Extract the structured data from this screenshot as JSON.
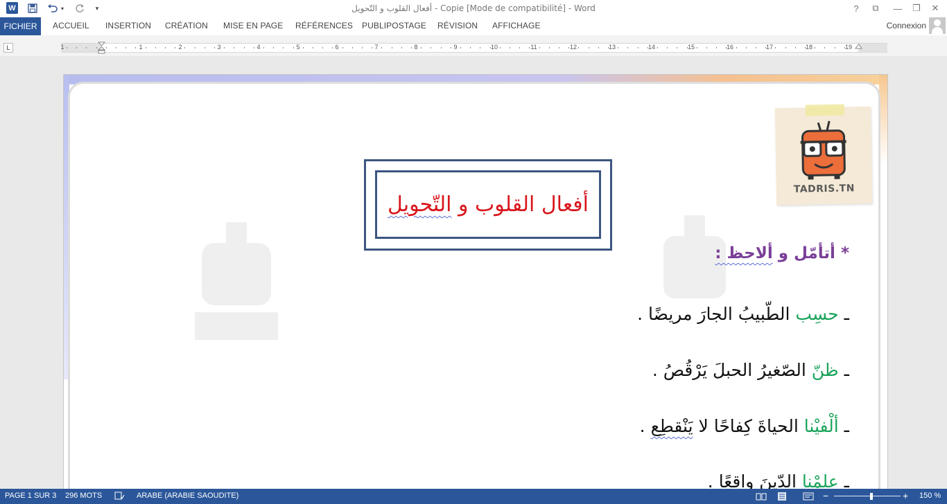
{
  "titlebar": {
    "title": "أفعال القلوب و التّحويل - Copie [Mode de compatibilité] - Word",
    "app_icon": "W",
    "help_glyph": "?",
    "restore_ribbon_glyph": "⧉",
    "minimize_glyph": "—",
    "maximize_glyph": "❐",
    "close_glyph": "✕"
  },
  "quick_access": {
    "save_icon": "save-icon",
    "undo_icon": "undo-icon",
    "redo_icon": "redo-icon",
    "customize_icon": "chevron-down-icon"
  },
  "ribbon": {
    "file_tab": "FICHIER",
    "tabs": [
      "ACCUEIL",
      "INSERTION",
      "CRÉATION",
      "MISE EN PAGE",
      "RÉFÉRENCES",
      "PUBLIPOSTAGE",
      "RÉVISION",
      "AFFICHAGE"
    ],
    "account": "Connexion"
  },
  "ruler": {
    "tab_selector": "L",
    "numbers": [
      "1",
      "1",
      "2",
      "3",
      "4",
      "5",
      "6",
      "7",
      "8",
      "9",
      "10",
      "11",
      "12",
      "13",
      "14",
      "15",
      "16",
      "17",
      "18",
      "19"
    ]
  },
  "document": {
    "title": "أفعال القلوب و التّحويل",
    "title_part1": "أفعال القلوب و ",
    "title_part2": "التّحويل",
    "logo_text": "TADRIS.TN",
    "heading_star": "* ",
    "heading_part1": "أتأمّل و ",
    "heading_part2": "ألاحظ :",
    "lines": [
      {
        "dash": "ـ ",
        "verb": "حسِب",
        "rest": " الطّبيبُ الجارَ مريضًا ."
      },
      {
        "dash": "ـ ",
        "verb": "ظنّ",
        "rest": " الصّغيرُ الحبلَ يَرْقُصُ ."
      },
      {
        "dash": "ـ ",
        "verb": "ألْفيْنا",
        "rest": " الحياةَ كِفاحًا لا ",
        "rest2": "يَنْقطِع",
        "rest3": " ."
      },
      {
        "dash": "ـ ",
        "verb": "علمْنا",
        "rest": " الدّينَ واقعًا ."
      }
    ]
  },
  "statusbar": {
    "page": "PAGE 1 SUR 3",
    "words": "296 MOTS",
    "language": "ARABE (ARABIE SAOUDITE)",
    "zoom": "150 %",
    "zoom_minus": "−",
    "zoom_plus": "+",
    "zoom_value": 0.56
  },
  "colors": {
    "accent": "#2b579a",
    "title_red": "#d8161c",
    "box_blue": "#3c5581",
    "heading_purple": "#7a3f98",
    "verb_green": "#1aa35a"
  }
}
